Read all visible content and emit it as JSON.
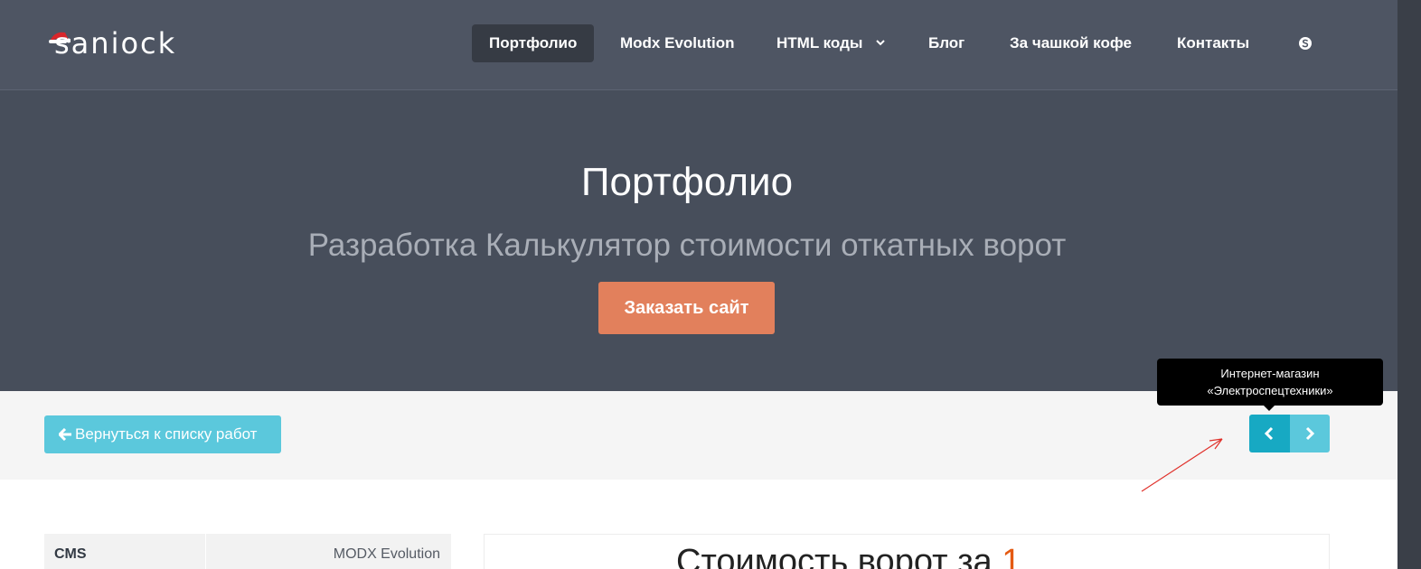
{
  "brand": {
    "logo_text": "saniock"
  },
  "nav": {
    "items": [
      {
        "label": "Портфолио",
        "active": true
      },
      {
        "label": "Modx Evolution"
      },
      {
        "label": "HTML коды"
      },
      {
        "label": "Блог"
      },
      {
        "label": "За чашкой кофе"
      },
      {
        "label": "Контакты"
      }
    ],
    "skype_icon": "skype-icon"
  },
  "hero": {
    "title": "Портфолио",
    "subtitle": "Разработка Калькулятор стоимости откатных ворот",
    "order_button": "Заказать сайт"
  },
  "toolbar": {
    "back_label": "Вернуться к списку работ",
    "tooltip_line1": "Интернет-магазин",
    "tooltip_line2": "«Электроспецтехники»"
  },
  "details": {
    "label": "CMS",
    "value": "MODX Evolution"
  },
  "preview": {
    "text": "Стоимость ворот за",
    "number": "1"
  },
  "colors": {
    "header_bg": "#474e5b",
    "accent_orange": "#e2805c",
    "accent_cyan": "#5bc8dc",
    "accent_cyan_dark": "#17a9c3",
    "annotation_red": "#e0302a"
  }
}
